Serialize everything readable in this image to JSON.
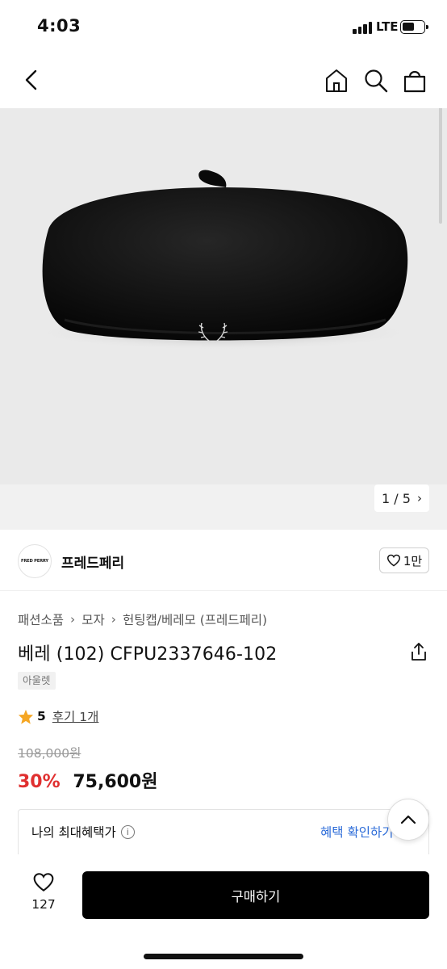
{
  "status_bar": {
    "time": "4:03",
    "network": "LTE"
  },
  "nav": {
    "back_icon": "chevron-left-icon",
    "home_icon": "home-icon",
    "search_icon": "search-icon",
    "cart_icon": "shopping-bag-icon"
  },
  "gallery": {
    "current": "1",
    "total": "5",
    "counter": "1 / 5"
  },
  "brand": {
    "logo_text": "FRED PERRY",
    "name": "프레드페리",
    "likes": "1만"
  },
  "breadcrumb": [
    "패션소품",
    "모자",
    "헌팅캡/베레모 (프레드페리)"
  ],
  "product": {
    "title": "베레 (102) CFPU2337646-102",
    "tag": "아울렛",
    "rating": "5",
    "reviews": "후기 1개",
    "original_price": "108,000원",
    "discount": "30%",
    "price": "75,600원"
  },
  "benefit": {
    "label": "나의 최대혜택가",
    "link": "혜택 확인하기"
  },
  "bottom_bar": {
    "wish_count": "127",
    "buy_label": "구매하기"
  },
  "colors": {
    "accent_red": "#e03030",
    "link_blue": "#2b6bd8",
    "star": "#f5a623",
    "button": "#000000"
  }
}
